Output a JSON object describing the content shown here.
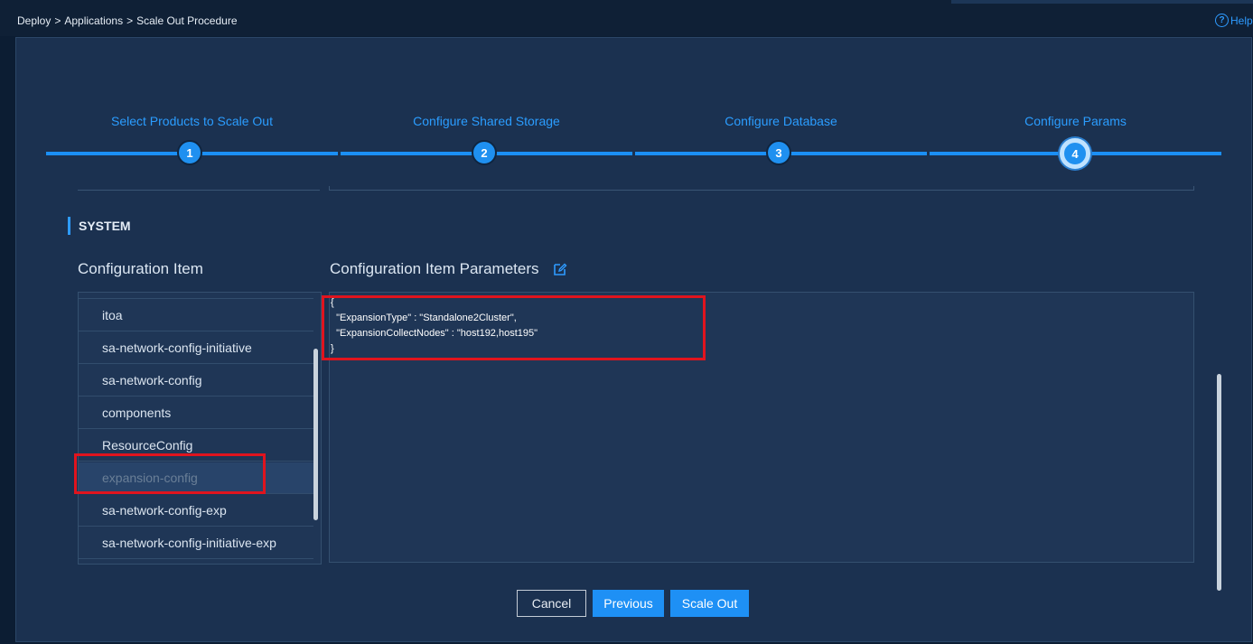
{
  "breadcrumb": [
    "Deploy",
    ">",
    "Applications",
    ">",
    "Scale Out Procedure"
  ],
  "help_label": "Help",
  "steps": [
    {
      "label": "Select Products to Scale Out",
      "num": "1"
    },
    {
      "label": "Configure Shared Storage",
      "num": "2"
    },
    {
      "label": "Configure Database",
      "num": "3"
    },
    {
      "label": "Configure Params",
      "num": "4"
    }
  ],
  "section_title": "SYSTEM",
  "config_item_title": "Configuration Item",
  "config_params_title": "Configuration Item Parameters",
  "config_items": [
    {
      "label": "itoa"
    },
    {
      "label": "sa-network-config-initiative"
    },
    {
      "label": "sa-network-config"
    },
    {
      "label": "components"
    },
    {
      "label": "ResourceConfig"
    },
    {
      "label": "expansion-config"
    },
    {
      "label": "sa-network-config-exp"
    },
    {
      "label": "sa-network-config-initiative-exp"
    }
  ],
  "selected_item": "expansion-config",
  "params_text": "{\n  \"ExpansionType\" : \"Standalone2Cluster\",\n  \"ExpansionCollectNodes\" : \"host192,host195\"\n}",
  "buttons": {
    "cancel": "Cancel",
    "previous": "Previous",
    "scale_out": "Scale Out"
  },
  "colors": {
    "accent": "#1e90f5",
    "highlight": "#e0141e",
    "background": "#1b3150"
  },
  "icons": {
    "help": "question-circle-icon",
    "edit": "edit-icon"
  }
}
